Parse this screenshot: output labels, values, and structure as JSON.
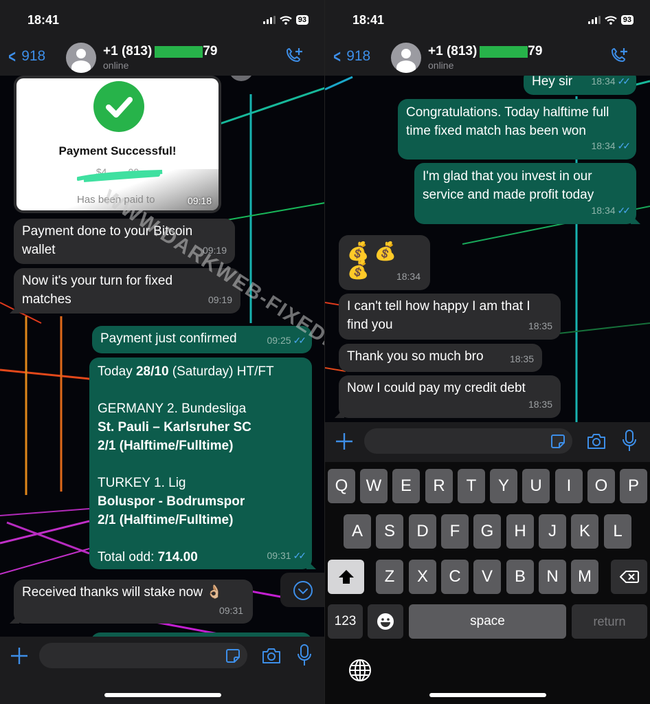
{
  "status_bar": {
    "time": "18:41",
    "battery": "93"
  },
  "header": {
    "back_count": "918",
    "contact_prefix": "+1 (813)",
    "contact_suffix": "79",
    "contact_status": "online"
  },
  "left_chat": {
    "payment_image": {
      "title": "Payment Successful!",
      "amount_redacted": "$4,___.00",
      "subtitle": "Has been paid to",
      "time": "09:18"
    },
    "messages": [
      {
        "dir": "in",
        "text": "Payment done to your Bitcoin wallet",
        "time": "09:19"
      },
      {
        "dir": "in",
        "text": "Now it's your turn for fixed matches",
        "time": "09:19"
      },
      {
        "dir": "out",
        "text": "Payment just confirmed",
        "time": "09:25",
        "read": true
      },
      {
        "dir": "out",
        "time": "09:31",
        "read": true,
        "lines": {
          "today_prefix": "Today ",
          "today_date": "28/10",
          "today_suffix": " (Saturday) HT/FT",
          "league1": "GERMANY 2. Bundesliga",
          "match1": "St. Pauli – Karlsruher SC",
          "tip1": "2/1 (Halftime/Fulltime)",
          "league2": "TURKEY 1. Lig",
          "match2": "Boluspor - Bodrumspor",
          "tip2": "2/1 (Halftime/Fulltime)",
          "total_label": "Total odd: ",
          "total_value": "714.00"
        }
      },
      {
        "dir": "in",
        "text": "Received thanks will stake now 👌🏼",
        "time": "09:31"
      }
    ]
  },
  "right_chat": {
    "messages": [
      {
        "dir": "out",
        "text": "Hey sir",
        "time": "18:34",
        "read": true
      },
      {
        "dir": "out",
        "text": "Congratulations. Today halftime full time fixed match has been won",
        "time": "18:34",
        "read": true
      },
      {
        "dir": "out",
        "text": "I'm glad that you invest in our service and made profit today",
        "time": "18:34",
        "read": true
      },
      {
        "dir": "in",
        "text": "💰 💰 💰",
        "time": "18:34"
      },
      {
        "dir": "in",
        "text": "I can't tell how happy I am that I find you",
        "time": "18:35"
      },
      {
        "dir": "in",
        "text": "Thank you so much bro",
        "time": "18:35"
      },
      {
        "dir": "in",
        "text": "Now I could pay my credit debt",
        "time": "18:35"
      }
    ]
  },
  "input": {
    "placeholder": ""
  },
  "keyboard": {
    "row1": [
      "Q",
      "W",
      "E",
      "R",
      "T",
      "Y",
      "U",
      "I",
      "O",
      "P"
    ],
    "row2": [
      "A",
      "S",
      "D",
      "F",
      "G",
      "H",
      "J",
      "K",
      "L"
    ],
    "row3": [
      "Z",
      "X",
      "C",
      "V",
      "B",
      "N",
      "M"
    ],
    "numbers": "123",
    "space": "space",
    "return": "return"
  },
  "watermark": {
    "left": "WWW.DARKWEB-FIXEDMATCHES.COM"
  },
  "colors": {
    "accent": "#3d8ee8",
    "outgoing": "#0d5c4c",
    "incoming": "#2c2c2e",
    "redaction": "#27b34a"
  }
}
